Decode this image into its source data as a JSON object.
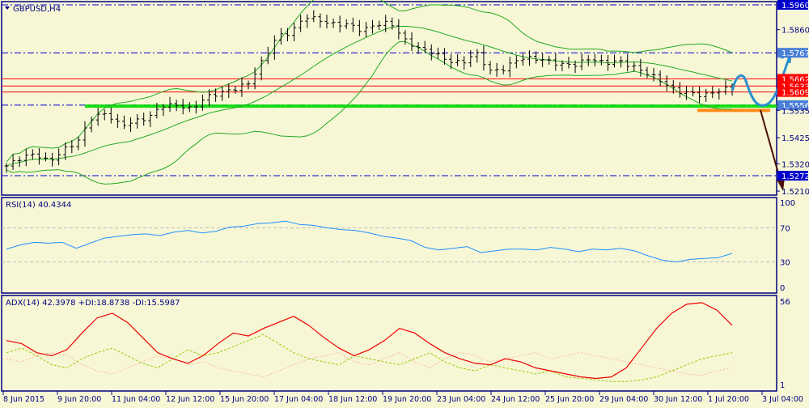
{
  "chart_data": {
    "type": "candlestick",
    "symbol_title": "GBPUSD,H4",
    "price_axis": {
      "range": [
        1.519,
        1.5975
      ],
      "ticks": [
        "1.5960",
        "1.5860",
        "1.5767",
        "1.5662",
        "1.5633",
        "1.5609",
        "1.5556",
        "1.5535",
        "1.5425",
        "1.5320",
        "1.5272",
        "1.5210"
      ]
    },
    "levels": [
      {
        "label": "1.5960",
        "price": 1.596,
        "style": "dashdot",
        "color": "#0000cc",
        "tag_bg": "#0000cc"
      },
      {
        "label": "1.5767",
        "price": 1.5767,
        "style": "dashdot",
        "color": "#0000cc",
        "tag_bg": "#4a7fd8"
      },
      {
        "label": "1.5662",
        "price": 1.5662,
        "style": "solid",
        "color": "#ff0000",
        "tag_bg": "#ff0000"
      },
      {
        "label": "1.5633",
        "price": 1.5633,
        "style": "solid",
        "color": "#ff0000",
        "tag_bg": "#ff0000"
      },
      {
        "label": "1.5609",
        "price": 1.5609,
        "style": "solid",
        "color": "#ff0000",
        "tag_bg": "#ff0000"
      },
      {
        "label": "1.5556",
        "price": 1.5556,
        "style": "dashdot",
        "color": "#0000cc",
        "tag_bg": "#4a7fd8"
      },
      {
        "label": "1.5272",
        "price": 1.5272,
        "style": "dashdot",
        "color": "#0000cc",
        "tag_bg": "#0000cc"
      }
    ],
    "support_line": {
      "price": 1.5552,
      "color": "#00dd00"
    },
    "orange_line": {
      "price": 1.5535,
      "color": "#ff8c1a"
    },
    "close_keyframes": [
      1.5311,
      1.5344,
      1.536,
      1.5327,
      1.5376,
      1.5409,
      1.5507,
      1.5523,
      1.5474,
      1.549,
      1.5507,
      1.5556,
      1.5556,
      1.5539,
      1.5588,
      1.5605,
      1.5621,
      1.5644,
      1.5735,
      1.5833,
      1.5849,
      1.5914,
      1.5898,
      1.5882,
      1.5882,
      1.5856,
      1.5882,
      1.5888,
      1.5817,
      1.5784,
      1.5768,
      1.5735,
      1.5725,
      1.5768,
      1.5693,
      1.5702,
      1.5745,
      1.5745,
      1.5735,
      1.5719,
      1.5719,
      1.5745,
      1.5725,
      1.5735,
      1.5712,
      1.5686,
      1.5654,
      1.5614,
      1.5605,
      1.5595,
      1.5614,
      1.5627
    ],
    "bollinger": {
      "period": 20,
      "deviation": 2,
      "color": "#22aa22"
    },
    "time_labels": [
      "8 Jun 2015",
      "9 Jun 20:00",
      "11 Jun 04:00",
      "12 Jun 12:00",
      "15 Jun 20:00",
      "17 Jun 04:00",
      "18 Jun 12:00",
      "19 Jun 20:00",
      "23 Jun 04:00",
      "24 Jun 12:00",
      "25 Jun 20:00",
      "29 Jun 04:00",
      "30 Jun 12:00",
      "1 Jul 20:00",
      "3 Jul 04:00"
    ],
    "rsi": {
      "title": "RSI(14) 40.4344",
      "ticks": [
        "100",
        "70",
        "30",
        "0"
      ],
      "levels": [
        70,
        30
      ],
      "color": "#1e90ff",
      "values": [
        45,
        50,
        53,
        52,
        53,
        46,
        52,
        58,
        60,
        62,
        63,
        61,
        65,
        67,
        64,
        66,
        71,
        72,
        75,
        76,
        78,
        74,
        73,
        70,
        68,
        67,
        64,
        60,
        58,
        55,
        47,
        44,
        46,
        48,
        41,
        43,
        45,
        45,
        44,
        47,
        45,
        42,
        45,
        44,
        46,
        43,
        37,
        32,
        30,
        33,
        34,
        35,
        40
      ]
    },
    "adx": {
      "title": "ADX(14) 42.3978 +DI:18.8738 -DI:15.5987",
      "ticks": [
        "56",
        "1"
      ],
      "range": [
        1,
        56
      ],
      "adx_values": [
        30,
        28,
        22,
        20,
        24,
        35,
        45,
        48,
        42,
        32,
        22,
        18,
        15,
        20,
        28,
        35,
        33,
        38,
        42,
        46,
        40,
        32,
        25,
        20,
        24,
        30,
        38,
        35,
        28,
        22,
        18,
        15,
        14,
        18,
        16,
        12,
        10,
        8,
        6,
        5,
        6,
        12,
        25,
        38,
        48,
        54,
        55,
        50,
        40
      ],
      "plus_di_values": [
        22,
        25,
        20,
        14,
        12,
        18,
        22,
        25,
        20,
        15,
        12,
        18,
        24,
        20,
        22,
        26,
        30,
        34,
        28,
        22,
        18,
        16,
        14,
        20,
        18,
        16,
        14,
        18,
        22,
        16,
        12,
        10,
        14,
        12,
        10,
        8,
        10,
        6,
        5,
        4,
        3,
        3,
        4,
        6,
        10,
        14,
        18,
        20,
        22
      ],
      "minus_di_values": [
        18,
        16,
        20,
        22,
        20,
        14,
        10,
        8,
        12,
        16,
        20,
        18,
        14,
        16,
        12,
        10,
        8,
        6,
        10,
        14,
        18,
        20,
        22,
        16,
        14,
        18,
        22,
        16,
        12,
        18,
        22,
        20,
        16,
        18,
        20,
        22,
        18,
        20,
        22,
        20,
        18,
        16,
        14,
        12,
        10,
        8,
        7,
        10,
        12
      ],
      "adx_color": "#ee0000",
      "plus_color": "#99cc00",
      "minus_color": "#ffb6a0"
    }
  },
  "colors": {
    "axis": "#000080",
    "background": "#f7f7d6",
    "forecast": "#2b8fcf",
    "arrow": "#4a0f05"
  }
}
